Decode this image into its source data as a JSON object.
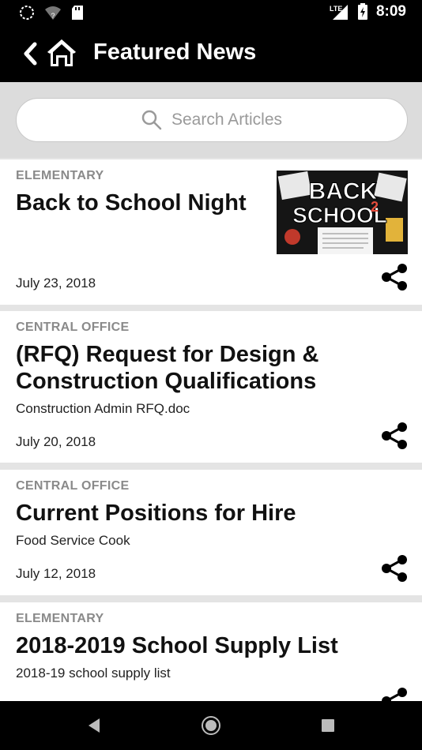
{
  "status_bar": {
    "time": "8:09",
    "network": "LTE"
  },
  "header": {
    "title": "Featured News"
  },
  "search": {
    "placeholder": "Search Articles"
  },
  "articles": [
    {
      "category": "ELEMENTARY",
      "title": "Back to School Night",
      "subtitle": "",
      "date": "July 23, 2018",
      "thumbnail": {
        "line1": "BACK",
        "line2": "SCHOOL",
        "accent": "2"
      }
    },
    {
      "category": "CENTRAL OFFICE",
      "title_line1": "(RFQ) Request for Design &",
      "title_line2": "Construction Qualifications",
      "subtitle": "Construction Admin RFQ.doc",
      "date": "July 20, 2018"
    },
    {
      "category": "CENTRAL OFFICE",
      "title": "Current Positions for Hire",
      "subtitle": "Food Service Cook",
      "date": "July 12, 2018"
    },
    {
      "category": "ELEMENTARY",
      "title": "2018-2019 School Supply List",
      "subtitle": "2018-19 school supply list",
      "date": ""
    }
  ],
  "colors": {
    "app_bar": "#000000",
    "category_text": "#8a8a8a",
    "divider": "#dcdcdc"
  }
}
